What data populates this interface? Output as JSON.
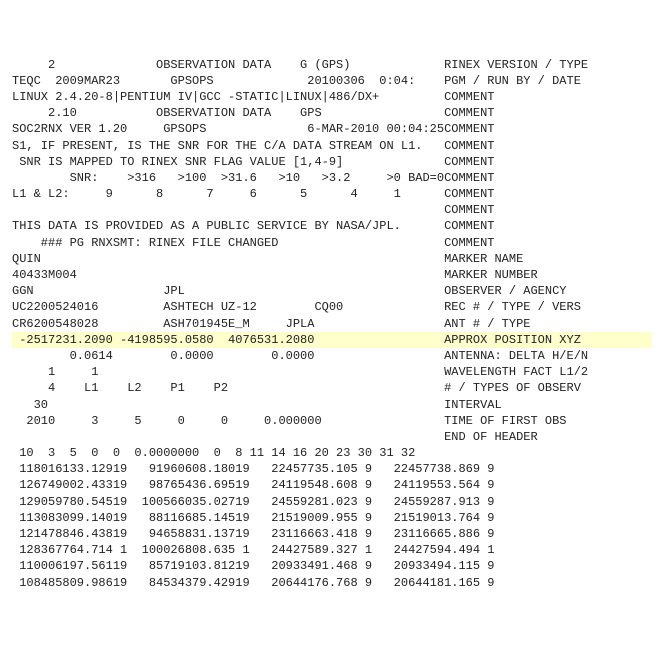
{
  "lines": [
    {
      "text": "     2              OBSERVATION DATA    G (GPS)             RINEX VERSION / TYPE",
      "hl": false
    },
    {
      "text": "TEQC  2009MAR23       GPSOPS             20100306  0:04:    PGM / RUN BY / DATE",
      "hl": false
    },
    {
      "text": "LINUX 2.4.20-8|PENTIUM IV|GCC -STATIC|LINUX|486/DX+         COMMENT",
      "hl": false
    },
    {
      "text": "     2.10           OBSERVATION DATA    GPS                 COMMENT",
      "hl": false
    },
    {
      "text": "SOC2RNX VER 1.20     GPSOPS              6-MAR-2010 00:04:25COMMENT",
      "hl": false
    },
    {
      "text": "S1, IF PRESENT, IS THE SNR FOR THE C/A DATA STREAM ON L1.   COMMENT",
      "hl": false
    },
    {
      "text": " SNR IS MAPPED TO RINEX SNR FLAG VALUE [1,4-9]              COMMENT",
      "hl": false
    },
    {
      "text": "        SNR:    >316   >100  >31.6   >10   >3.2     >0 BAD=0COMMENT",
      "hl": false
    },
    {
      "text": "L1 & L2:     9      8      7     6      5      4     1      COMMENT",
      "hl": false
    },
    {
      "text": "                                                            COMMENT",
      "hl": false
    },
    {
      "text": "THIS DATA IS PROVIDED AS A PUBLIC SERVICE BY NASA/JPL.      COMMENT",
      "hl": false
    },
    {
      "text": "    ### PG RNXSMT: RINEX FILE CHANGED                       COMMENT",
      "hl": false
    },
    {
      "text": "QUIN                                                        MARKER NAME",
      "hl": false
    },
    {
      "text": "40433M004                                                   MARKER NUMBER",
      "hl": false
    },
    {
      "text": "GGN                  JPL                                    OBSERVER / AGENCY",
      "hl": false
    },
    {
      "text": "UC2200524016         ASHTECH UZ-12        CQ00              REC # / TYPE / VERS",
      "hl": false
    },
    {
      "text": "CR6200548028         ASH701945E_M     JPLA                  ANT # / TYPE",
      "hl": false
    },
    {
      "text": " -2517231.2090 -4198595.0580  4076531.2080                  APPROX POSITION XYZ",
      "hl": true
    },
    {
      "text": "        0.0614        0.0000        0.0000                  ANTENNA: DELTA H/E/N",
      "hl": false
    },
    {
      "text": "     1     1                                                WAVELENGTH FACT L1/2",
      "hl": false
    },
    {
      "text": "     4    L1    L2    P1    P2                              # / TYPES OF OBSERV",
      "hl": false
    },
    {
      "text": "   30                                                       INTERVAL",
      "hl": false
    },
    {
      "text": "  2010     3     5     0     0     0.000000                 TIME OF FIRST OBS",
      "hl": false
    },
    {
      "text": "                                                            END OF HEADER",
      "hl": false
    },
    {
      "text": "",
      "hl": false
    },
    {
      "text": " 10  3  5  0  0  0.0000000  0  8 11 14 16 20 23 30 31 32",
      "hl": false
    },
    {
      "text": " 118016133.12919   91960608.18019   22457735.105 9   22457738.869 9",
      "hl": false
    },
    {
      "text": " 126749002.43319   98765436.69519   24119548.608 9   24119553.564 9",
      "hl": false
    },
    {
      "text": " 129059780.54519  100566035.02719   24559281.023 9   24559287.913 9",
      "hl": false
    },
    {
      "text": " 113083099.14019   88116685.14519   21519009.955 9   21519013.764 9",
      "hl": false
    },
    {
      "text": " 121478846.43819   94658831.13719   23116663.418 9   23116665.886 9",
      "hl": false
    },
    {
      "text": " 128367764.714 1  100026808.635 1   24427589.327 1   24427594.494 1",
      "hl": false
    },
    {
      "text": " 110006197.56119   85719103.81219   20933491.468 9   20933494.115 9",
      "hl": false
    },
    {
      "text": " 108485809.98619   84534379.42919   20644176.768 9   20644181.165 9",
      "hl": false
    }
  ]
}
